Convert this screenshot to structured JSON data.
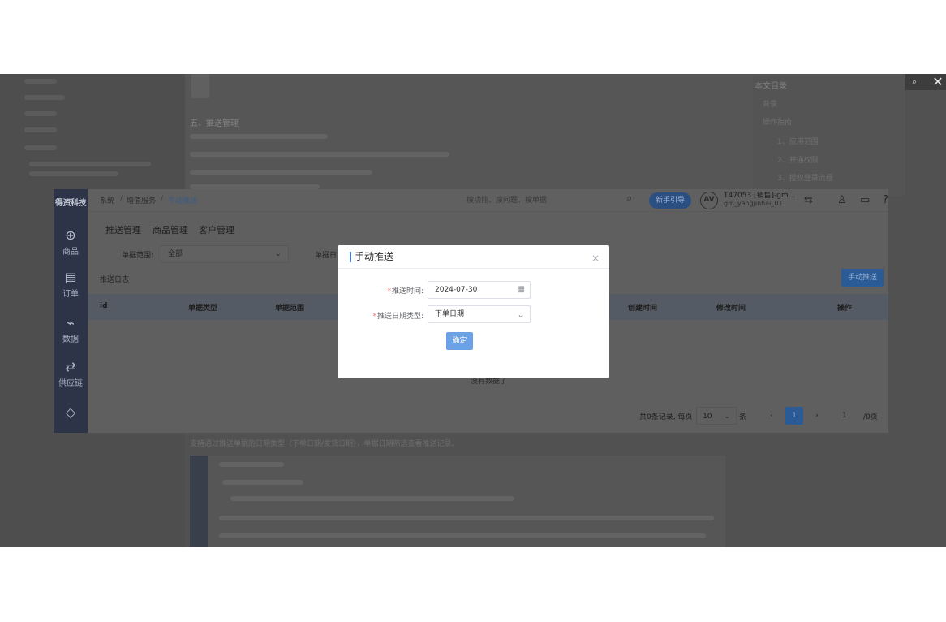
{
  "viewer": {
    "search_glyph": "⌕",
    "close_glyph": "✕"
  },
  "doc": {
    "heading": "五、推送管理",
    "toc_title": "本文目录",
    "toc_items": [
      "背景",
      "操作指南",
      "1、应用范围",
      "2、开通权限",
      "3、授权登录流程"
    ],
    "lower_text": "支持通过推送单据的日期类型（下单日期/发货日期），单据日期筛选查看推送记录。"
  },
  "app": {
    "logo": "得资科技",
    "sidebar": [
      {
        "icon": "bag-icon",
        "glyph": "⊕",
        "label": "商品"
      },
      {
        "icon": "order-icon",
        "glyph": "▤",
        "label": "订单"
      },
      {
        "icon": "chart-icon",
        "glyph": "⌁",
        "label": "数据"
      },
      {
        "icon": "supply-icon",
        "glyph": "⇄",
        "label": "供应链"
      },
      {
        "icon": "cube-icon",
        "glyph": "◇",
        "label": ""
      }
    ],
    "breadcrumb": [
      "系统",
      "增值服务",
      "手动推送"
    ],
    "search_placeholder": "搜功能、搜问题、搜单据",
    "guide_label": "新手引导",
    "avatar_text": "AV",
    "user_name": "T47053 [销售]-gm...",
    "user_sub": "gm_yangjinhai_01",
    "subnav": [
      "推送管理",
      "商品管理",
      "客户管理"
    ],
    "filter_label": "单据范围:",
    "filter_value": "全部",
    "filter_label2": "单据日",
    "log_title": "推送日志",
    "manual_push_label": "手动推送",
    "columns": [
      "id",
      "单据类型",
      "单据范围",
      "创建时间",
      "修改时间",
      "操作"
    ],
    "empty_text": "没有数据了",
    "pager": {
      "summary": "共0条记录, 每页",
      "page_size": "10",
      "unit": "条",
      "prev": "‹",
      "current": "1",
      "next": "›",
      "jump": "1",
      "total": "/0页"
    }
  },
  "modal": {
    "title": "手动推送",
    "close_glyph": "×",
    "push_time_label": "推送时间:",
    "push_time_value": "2024-07-30",
    "date_type_label": "推送日期类型:",
    "date_type_value": "下单日期",
    "required_mark": "*",
    "confirm_label": "确定",
    "accent": "#3a7bd5"
  }
}
